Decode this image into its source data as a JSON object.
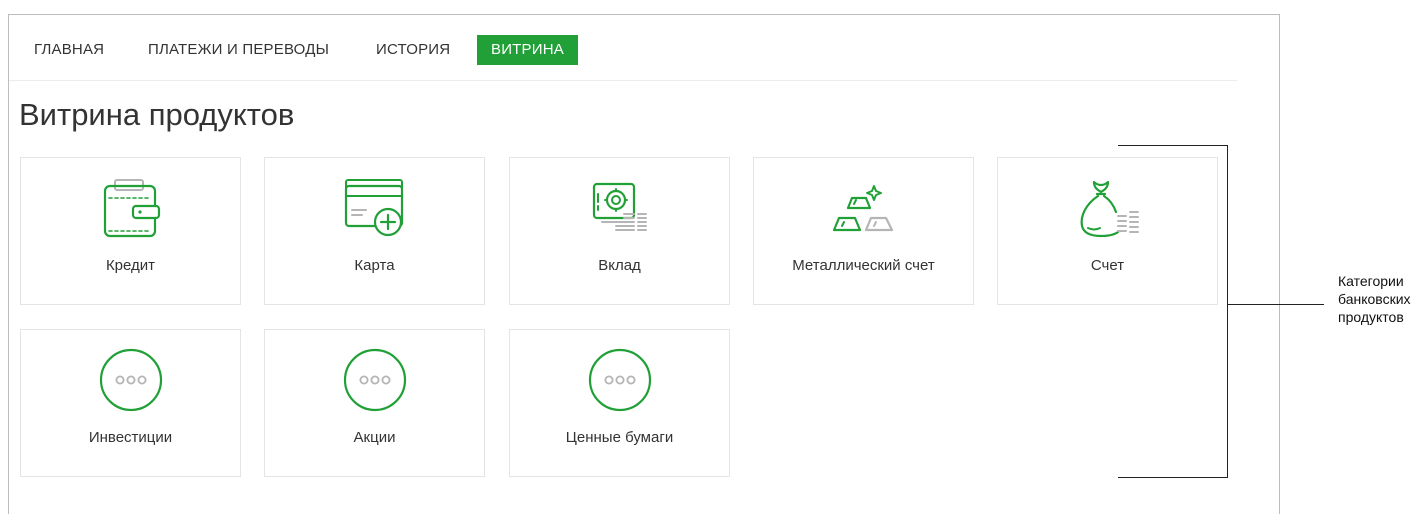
{
  "nav": {
    "items": [
      {
        "label": "ГЛАВНАЯ",
        "active": false
      },
      {
        "label": "ПЛАТЕЖИ И ПЕРЕВОДЫ",
        "active": false
      },
      {
        "label": "ИСТОРИЯ",
        "active": false
      },
      {
        "label": "ВИТРИНА",
        "active": true
      }
    ]
  },
  "page": {
    "title": "Витрина продуктов"
  },
  "products": [
    {
      "label": "Кредит",
      "icon": "wallet-icon"
    },
    {
      "label": "Карта",
      "icon": "card-add-icon"
    },
    {
      "label": "Вклад",
      "icon": "safe-icon"
    },
    {
      "label": "Металлический счет",
      "icon": "gold-bars-icon"
    },
    {
      "label": "Счет",
      "icon": "money-bag-icon"
    },
    {
      "label": "Инвестиции",
      "icon": "more-icon"
    },
    {
      "label": "Акции",
      "icon": "more-icon"
    },
    {
      "label": "Ценные бумаги",
      "icon": "more-icon"
    }
  ],
  "annotation": {
    "lines": [
      "Категории",
      "банковских",
      "продуктов"
    ]
  },
  "colors": {
    "accent": "#21a038",
    "icon_gray": "#b5b5b5"
  }
}
